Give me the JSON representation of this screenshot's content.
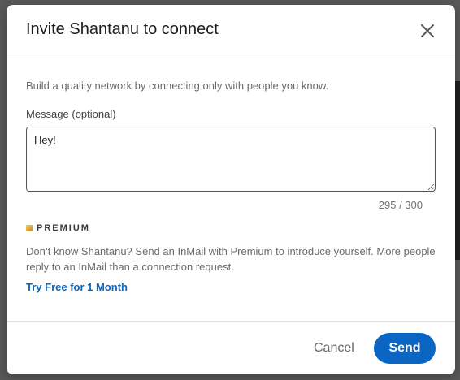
{
  "dialog": {
    "title": "Invite Shantanu to connect",
    "close_icon": "close-icon"
  },
  "body": {
    "helper_text": "Build a quality network by connecting only with people you know.",
    "message_label": "Message (optional)",
    "message_value": "Hey! ",
    "char_counter": "295 / 300"
  },
  "premium": {
    "icon": "premium-icon",
    "label": "PREMIUM",
    "accent_color": "#c78a1f",
    "description": "Don’t know Shantanu? Send an InMail with Premium to introduce yourself. More people reply to an InMail than a connection request.",
    "link_label": "Try Free for 1 Month"
  },
  "footer": {
    "cancel_label": "Cancel",
    "send_label": "Send",
    "primary_color": "#0a66c2"
  }
}
